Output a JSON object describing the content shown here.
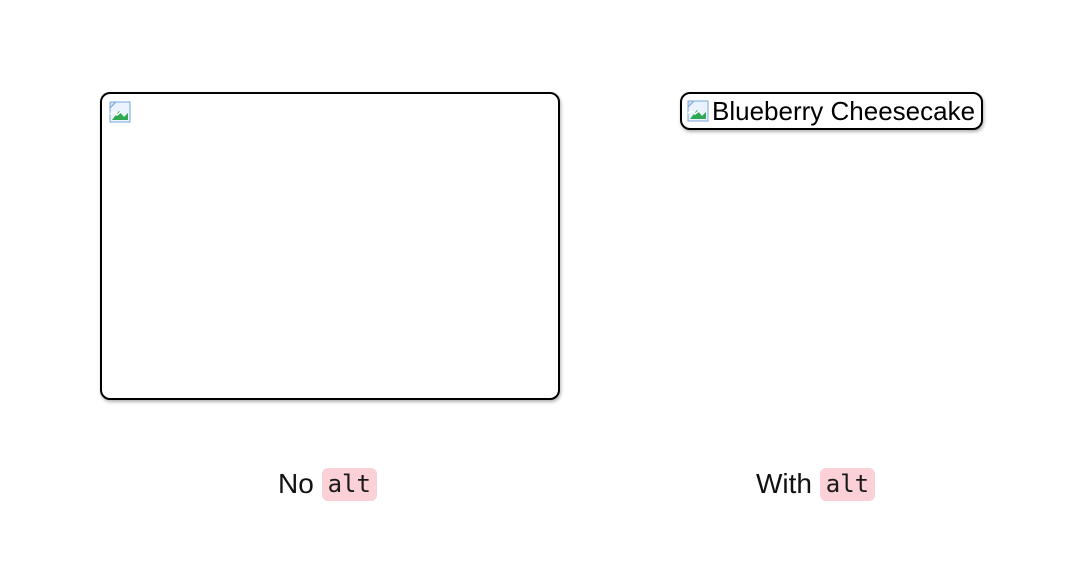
{
  "left": {
    "alt_text": "",
    "caption_prefix": "No ",
    "caption_code": "alt"
  },
  "right": {
    "alt_text": "Blueberry Cheesecake",
    "caption_prefix": "With ",
    "caption_code": "alt"
  }
}
